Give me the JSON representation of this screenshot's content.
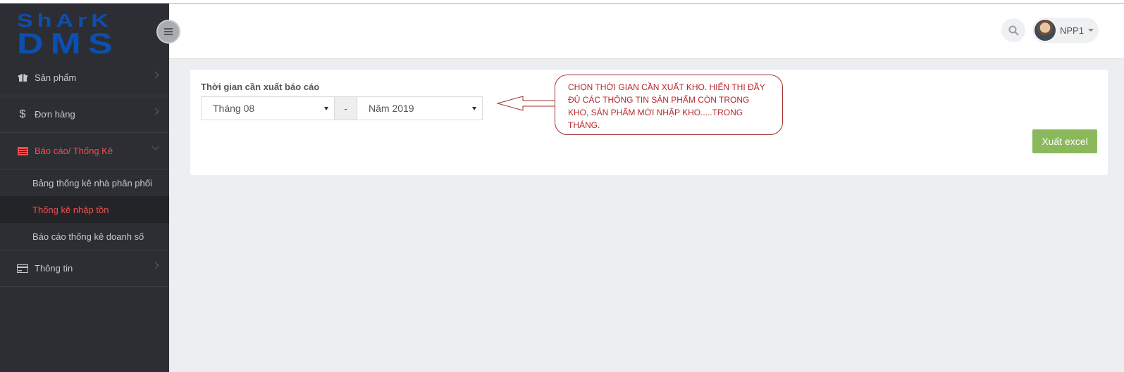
{
  "brand": {
    "logo_line1": "ShArK",
    "logo_line2": "DMS"
  },
  "sidebar": {
    "items": [
      {
        "label": "Sản phẩm",
        "icon": "gift-icon"
      },
      {
        "label": "Đơn hàng",
        "icon": "dollar-icon"
      },
      {
        "label": "Báo cáo/ Thống Kê",
        "icon": "report-icon",
        "active": true,
        "children": [
          {
            "label": "Bảng thống kê nhà phân phối"
          },
          {
            "label": "Thống kê nhập tồn",
            "current": true
          },
          {
            "label": "Báo cáo thống kê doanh số"
          }
        ]
      },
      {
        "label": "Thông tin",
        "icon": "card-icon"
      }
    ]
  },
  "header": {
    "user_name": "NPP1",
    "search_icon": "search-icon"
  },
  "form": {
    "label": "Thời gian cần xuất báo cáo",
    "month_value": "Tháng 08",
    "separator": "-",
    "year_value": "Năm 2019",
    "export_label": "Xuất excel"
  },
  "callout": {
    "text": "CHỌN THỜI GIAN CẦN XUẤT KHO. HIỂN THỊ ĐẦY ĐỦ CÁC THÔNG TIN SẢN PHẨM CÒN TRONG KHO, SẢN PHẨM MỚI NHẬP KHO.....TRONG THÁNG."
  },
  "colors": {
    "sidebar_bg": "#2c2e33",
    "accent_red": "#ef4e4e",
    "export_green": "#8cb85c",
    "callout_red": "#b8272a",
    "logo_blue": "#0d4fb0"
  }
}
